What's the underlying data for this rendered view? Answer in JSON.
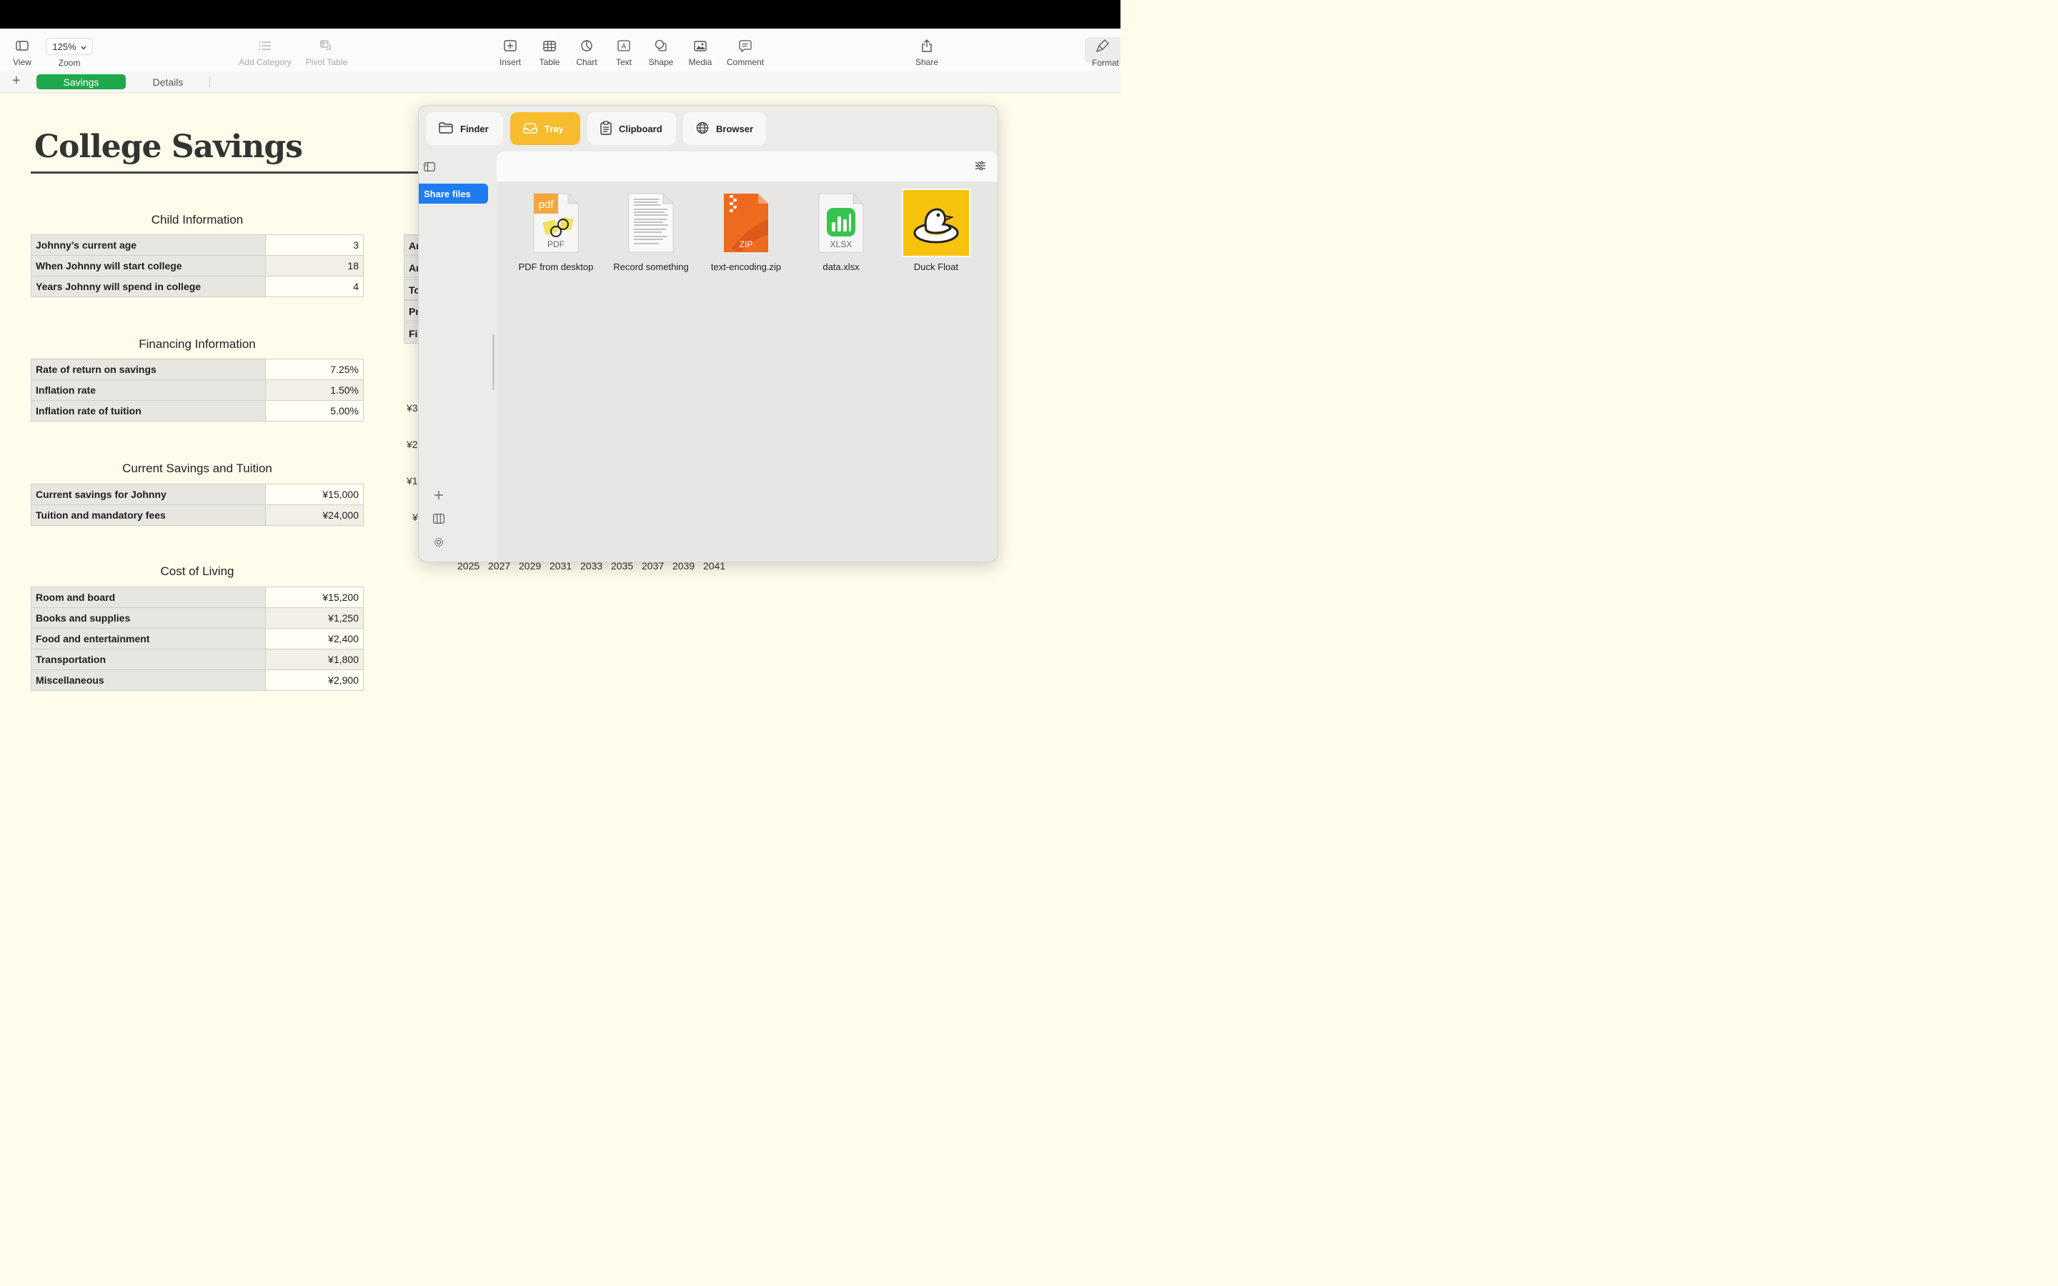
{
  "toolbar": {
    "view_label": "View",
    "zoom_value": "125%",
    "zoom_label": "Zoom",
    "add_category_label": "Add Category",
    "pivot_table_label": "Pivot Table",
    "insert_label": "Insert",
    "table_label": "Table",
    "chart_label": "Chart",
    "text_label": "Text",
    "shape_label": "Shape",
    "media_label": "Media",
    "comment_label": "Comment",
    "share_label": "Share",
    "format_label": "Format"
  },
  "sheets": {
    "add": "+",
    "active": "Savings",
    "other": "Details"
  },
  "document": {
    "title": "College Savings",
    "child_info": {
      "heading": "Child Information",
      "rows": [
        {
          "label": "Johnny’s current age",
          "value": "3"
        },
        {
          "label": "When Johnny will start college",
          "value": "18"
        },
        {
          "label": "Years Johnny will spend in college",
          "value": "4"
        }
      ]
    },
    "financing": {
      "heading": "Financing Information",
      "rows": [
        {
          "label": "Rate of return on savings",
          "value": "7.25%"
        },
        {
          "label": "Inflation rate",
          "value": "1.50%"
        },
        {
          "label": "Inflation rate of tuition",
          "value": "5.00%"
        }
      ]
    },
    "savings_tuition": {
      "heading": "Current Savings and Tuition",
      "rows": [
        {
          "label": "Current savings for Johnny",
          "value": "¥15,000"
        },
        {
          "label": "Tuition and mandatory fees",
          "value": "¥24,000"
        }
      ]
    },
    "cost_of_living": {
      "heading": "Cost of Living",
      "rows": [
        {
          "label": "Room and board",
          "value": "¥15,200"
        },
        {
          "label": "Books and supplies",
          "value": "¥1,250"
        },
        {
          "label": "Food and entertainment",
          "value": "¥2,400"
        },
        {
          "label": "Transportation",
          "value": "¥1,800"
        },
        {
          "label": "Miscellaneous",
          "value": "¥2,900"
        }
      ]
    },
    "right_table_rows": [
      "An",
      "An",
      "To",
      "Pr",
      "Fi"
    ],
    "chart_y_labels": [
      "¥3",
      "¥2",
      "¥1",
      "¥"
    ],
    "chart_x_labels": [
      "2025",
      "2027",
      "2029",
      "2031",
      "2033",
      "2035",
      "2037",
      "2039",
      "2041"
    ]
  },
  "panel": {
    "tabs": {
      "finder": "Finder",
      "tray": "Tray",
      "clipboard": "Clipboard",
      "browser": "Browser"
    },
    "sidebar_item": "Share files",
    "files": [
      {
        "name": "PDF from desktop",
        "badge": "PDF",
        "corner": "pdf"
      },
      {
        "name": "Record something"
      },
      {
        "name": "text-encoding.zip",
        "badge": "ZIP"
      },
      {
        "name": "data.xlsx",
        "badge": "XLSX"
      },
      {
        "name": "Duck Float"
      }
    ]
  },
  "colors": {
    "accent_green": "#1fa84b",
    "tray_yellow": "#f9bc2e",
    "sidebar_blue": "#1e7cf2",
    "sheet_bg": "#fffcec"
  }
}
